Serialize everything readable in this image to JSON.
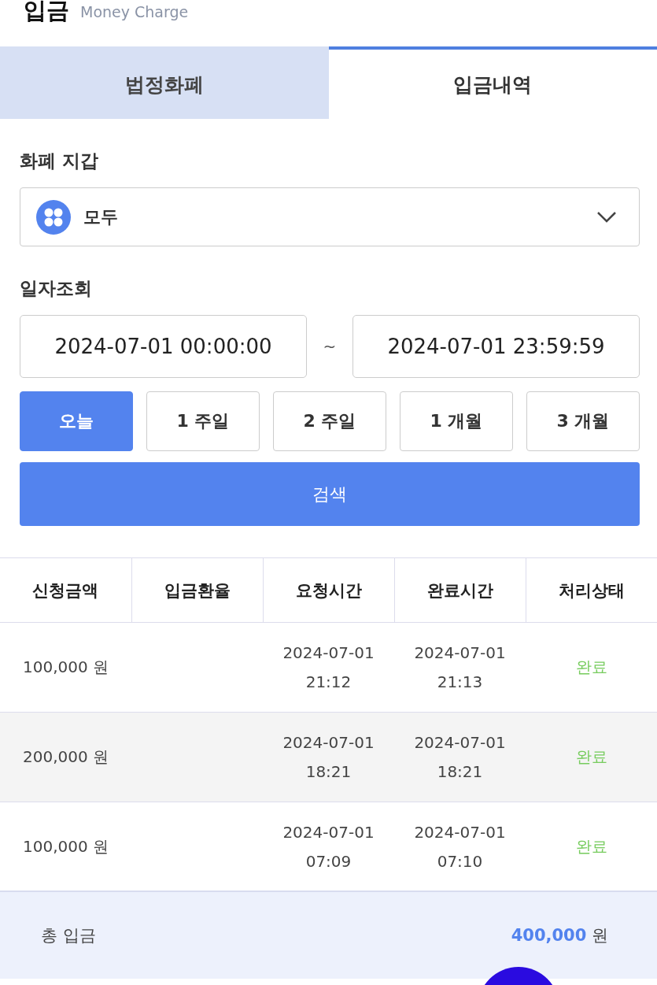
{
  "header": {
    "title": "입금",
    "subtitle": "Money Charge"
  },
  "tabs": [
    {
      "label": "법정화폐",
      "selected": false
    },
    {
      "label": "입금내역",
      "selected": true
    }
  ],
  "wallet": {
    "label": "화폐 지갑",
    "value": "모두"
  },
  "date_filter": {
    "label": "일자조회",
    "start": "2024-07-01 00:00:00",
    "separator": "~",
    "end": "2024-07-01 23:59:59"
  },
  "periods": [
    {
      "label": "오늘",
      "selected": true
    },
    {
      "label": "1 주일",
      "selected": false
    },
    {
      "label": "2 주일",
      "selected": false
    },
    {
      "label": "1 개월",
      "selected": false
    },
    {
      "label": "3 개월",
      "selected": false
    }
  ],
  "search_button": "검색",
  "table": {
    "columns": [
      "신청금액",
      "입금환율",
      "요청시간",
      "완료시간",
      "처리상태"
    ],
    "rows": [
      {
        "amount": "100,000 원",
        "request_time": "2024-07-01 21:12",
        "complete_time": "2024-07-01 21:13",
        "status": "완료"
      },
      {
        "amount": "200,000 원",
        "request_time": "2024-07-01 18:21",
        "complete_time": "2024-07-01 18:21",
        "status": "완료"
      },
      {
        "amount": "100,000 원",
        "request_time": "2024-07-01 07:09",
        "complete_time": "2024-07-01 07:10",
        "status": "완료"
      }
    ]
  },
  "summary": {
    "label": "총 입금",
    "amount": "400,000",
    "unit": "원"
  }
}
